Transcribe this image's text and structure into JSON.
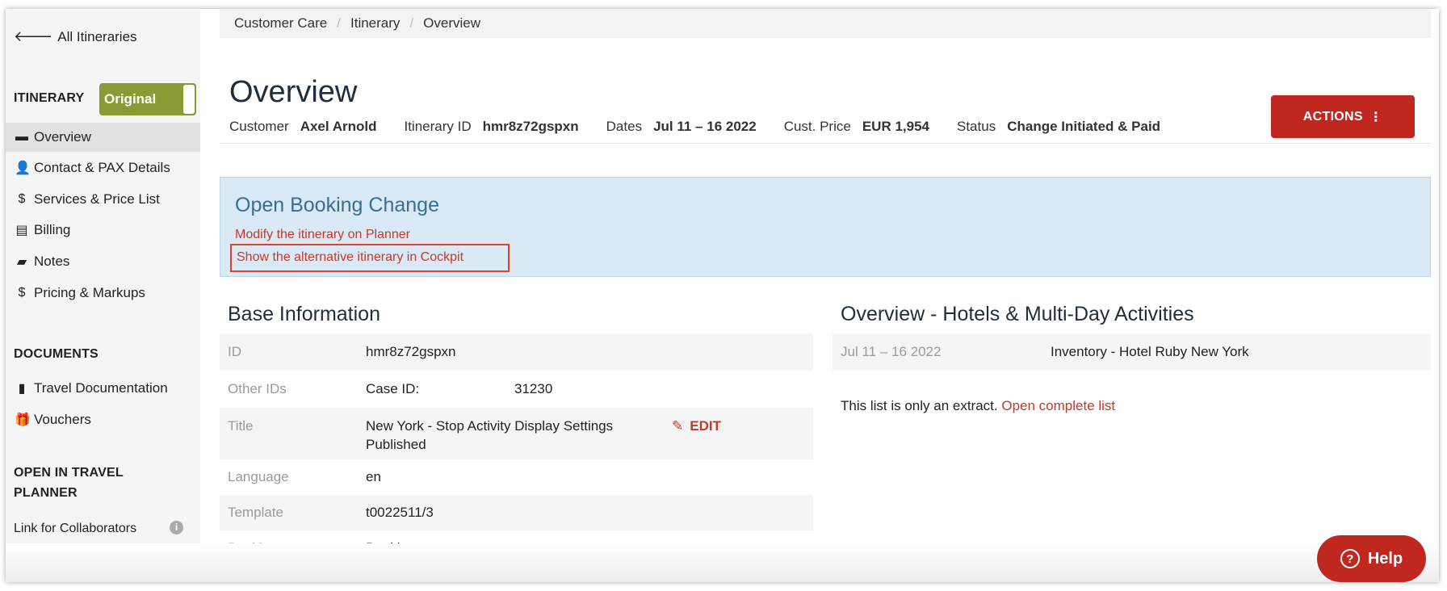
{
  "sidebar": {
    "back_label": "All Itineraries",
    "itinerary_title": "ITINERARY",
    "toggle_label": "Original",
    "items": [
      {
        "label": "Overview",
        "icon": "folder-icon"
      },
      {
        "label": "Contact & PAX Details",
        "icon": "user-icon"
      },
      {
        "label": "Services & Price List",
        "icon": "dollar-icon"
      },
      {
        "label": "Billing",
        "icon": "credit-card-icon"
      },
      {
        "label": "Notes",
        "icon": "comment-icon"
      },
      {
        "label": "Pricing & Markups",
        "icon": "dollar-icon"
      }
    ],
    "documents_title": "DOCUMENTS",
    "doc_items": [
      {
        "label": "Travel Documentation",
        "icon": "book-icon"
      },
      {
        "label": "Vouchers",
        "icon": "gift-icon"
      }
    ],
    "planner_title_1": "OPEN IN TRAVEL",
    "planner_title_2": "PLANNER",
    "collab_link": "Link for Collaborators"
  },
  "breadcrumb": [
    "Customer Care",
    "Itinerary",
    "Overview"
  ],
  "header": {
    "title": "Overview",
    "customer_label": "Customer",
    "customer_value": "Axel Arnold",
    "id_label": "Itinerary ID",
    "id_value": "hmr8z72gspxn",
    "dates_label": "Dates",
    "dates_value": "Jul 11 – 16 2022",
    "price_label": "Cust. Price",
    "price_value": "EUR 1,954",
    "status_label": "Status",
    "status_value": "Change Initiated & Paid",
    "actions_label": "ACTIONS"
  },
  "alert": {
    "title": "Open Booking Change",
    "link1": "Modify the itinerary on Planner",
    "link2": "Show the alternative itinerary in Cockpit"
  },
  "base_info": {
    "title": "Base Information",
    "rows": [
      {
        "key": "ID",
        "value": "hmr8z72gspxn"
      },
      {
        "key": "Other IDs",
        "value": "Case ID:",
        "value2": "31230"
      },
      {
        "key": "Title",
        "value": "New York - Stop Activity Display Settings",
        "value_line2": "Published",
        "edit": "EDIT"
      },
      {
        "key": "Language",
        "value": "en"
      },
      {
        "key": "Template",
        "value": "t0022511/3"
      },
      {
        "key": "Booking type",
        "value": "Booking"
      }
    ]
  },
  "hotels": {
    "title": "Overview - Hotels & Multi-Day Activities",
    "row_date": "Jul 11 – 16 2022",
    "row_name": "Inventory - Hotel Ruby New York",
    "extract_text": "This list is only an extract.",
    "extract_link": "Open complete list"
  },
  "help_label": "Help"
}
